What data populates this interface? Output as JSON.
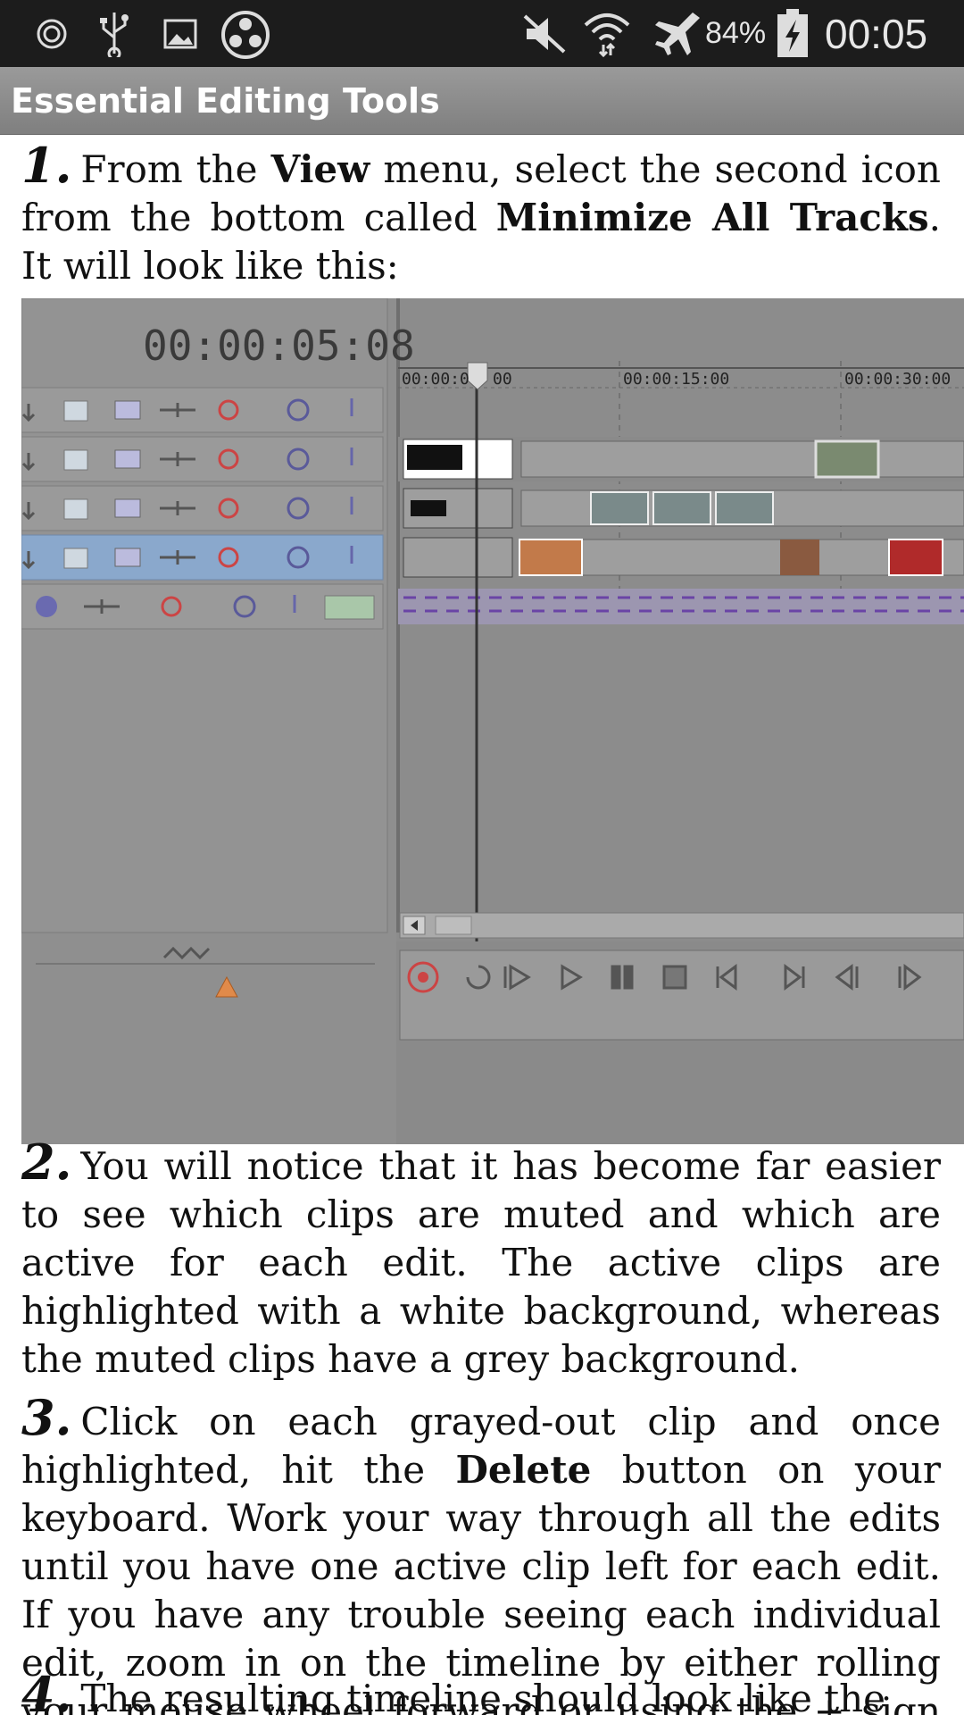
{
  "status_bar": {
    "battery_percent": "84%",
    "time": "00:05",
    "icons": [
      "data-saver-icon",
      "usb-icon",
      "gallery-icon",
      "media-icon",
      "mute-icon",
      "wifi-icon",
      "airplane-icon",
      "battery-charging-icon"
    ]
  },
  "app_bar": {
    "title": "Essential Editing Tools"
  },
  "article": {
    "step1": {
      "number": "1.",
      "t1": "From the ",
      "b1": "View",
      "t2": " menu, select the second icon from the bottom called ",
      "b2": "Minimize All Tracks",
      "t3": ". It will look like this:"
    },
    "step2": {
      "number": "2.",
      "text": "You will notice that it has become far easier to see which clips are muted and which are active for each edit. The active clips are highlighted with a white background, whereas the muted clips have a grey background."
    },
    "step3": {
      "number": "3.",
      "t1": "Click on each grayed-out clip and once highlighted, hit the ",
      "b1": "Delete",
      "t2": " button on your keyboard. Work your way through all the edits until you have one active clip left for each edit. If you have any trouble seeing each individual edit, zoom in on the timeline by either rolling your mouse wheel forward or using the + sign in the bottom right hand corner of the timeline."
    },
    "step4": {
      "number": "4.",
      "text": "The resulting timeline should look like the"
    }
  },
  "figure": {
    "timecode": "00:00:05:08",
    "ruler_labels": [
      "00:00:0",
      "00",
      "00:00:15:00",
      "00:00:30:00"
    ]
  }
}
